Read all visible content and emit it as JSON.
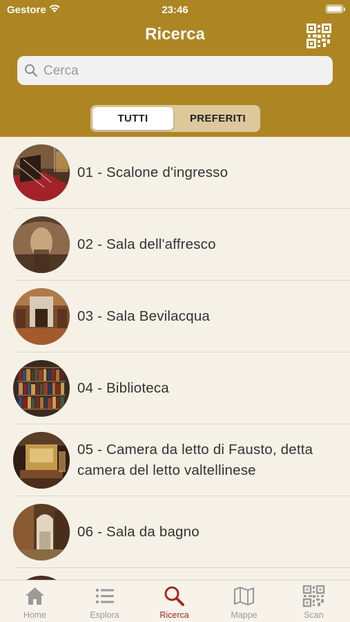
{
  "status": {
    "carrier": "Gestore",
    "time": "23:46"
  },
  "header": {
    "title": "Ricerca"
  },
  "search": {
    "placeholder": "Cerca"
  },
  "segment": {
    "all": "TUTTI",
    "favorites": "PREFERITI"
  },
  "items": [
    {
      "label": "01 - Scalone d'ingresso"
    },
    {
      "label": "02 - Sala dell'affresco"
    },
    {
      "label": "03 - Sala Bevilacqua"
    },
    {
      "label": "04 - Biblioteca"
    },
    {
      "label": "05 - Camera da letto di Fausto, detta camera del letto valtellinese"
    },
    {
      "label": "06 - Sala da bagno"
    }
  ],
  "tabs": [
    {
      "label": "Home",
      "icon": "home-icon"
    },
    {
      "label": "Esplora",
      "icon": "list-icon"
    },
    {
      "label": "Ricerca",
      "icon": "search-icon"
    },
    {
      "label": "Mappe",
      "icon": "map-icon"
    },
    {
      "label": "Scan",
      "icon": "qr-code-icon"
    }
  ],
  "colors": {
    "header": "#ad8523",
    "background": "#f6f1e7",
    "tab_active": "#a22a22",
    "tab_inactive": "#9a9a9a"
  }
}
